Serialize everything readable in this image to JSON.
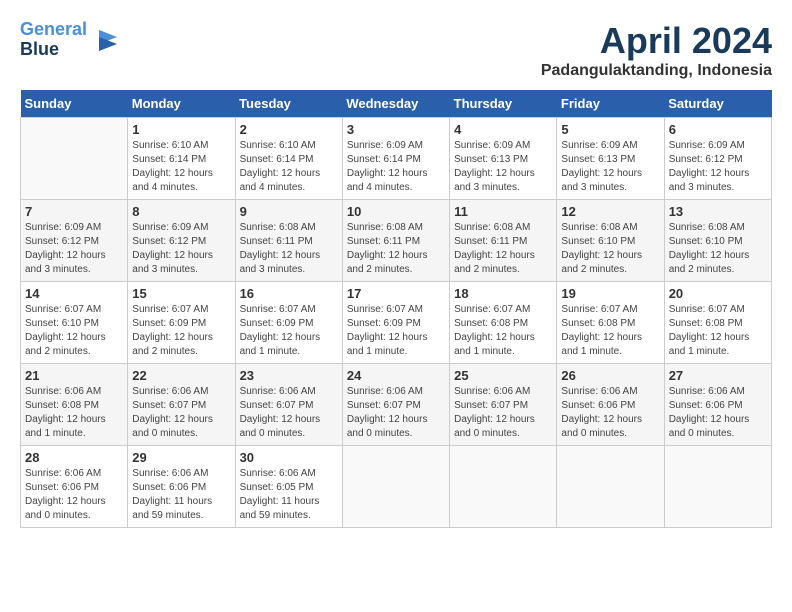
{
  "header": {
    "logo_line1": "General",
    "logo_line2": "Blue",
    "month_title": "April 2024",
    "location": "Padangulaktanding, Indonesia"
  },
  "days_of_week": [
    "Sunday",
    "Monday",
    "Tuesday",
    "Wednesday",
    "Thursday",
    "Friday",
    "Saturday"
  ],
  "weeks": [
    [
      {
        "day": "",
        "info": ""
      },
      {
        "day": "1",
        "info": "Sunrise: 6:10 AM\nSunset: 6:14 PM\nDaylight: 12 hours\nand 4 minutes."
      },
      {
        "day": "2",
        "info": "Sunrise: 6:10 AM\nSunset: 6:14 PM\nDaylight: 12 hours\nand 4 minutes."
      },
      {
        "day": "3",
        "info": "Sunrise: 6:09 AM\nSunset: 6:14 PM\nDaylight: 12 hours\nand 4 minutes."
      },
      {
        "day": "4",
        "info": "Sunrise: 6:09 AM\nSunset: 6:13 PM\nDaylight: 12 hours\nand 3 minutes."
      },
      {
        "day": "5",
        "info": "Sunrise: 6:09 AM\nSunset: 6:13 PM\nDaylight: 12 hours\nand 3 minutes."
      },
      {
        "day": "6",
        "info": "Sunrise: 6:09 AM\nSunset: 6:12 PM\nDaylight: 12 hours\nand 3 minutes."
      }
    ],
    [
      {
        "day": "7",
        "info": "Sunrise: 6:09 AM\nSunset: 6:12 PM\nDaylight: 12 hours\nand 3 minutes."
      },
      {
        "day": "8",
        "info": "Sunrise: 6:09 AM\nSunset: 6:12 PM\nDaylight: 12 hours\nand 3 minutes."
      },
      {
        "day": "9",
        "info": "Sunrise: 6:08 AM\nSunset: 6:11 PM\nDaylight: 12 hours\nand 3 minutes."
      },
      {
        "day": "10",
        "info": "Sunrise: 6:08 AM\nSunset: 6:11 PM\nDaylight: 12 hours\nand 2 minutes."
      },
      {
        "day": "11",
        "info": "Sunrise: 6:08 AM\nSunset: 6:11 PM\nDaylight: 12 hours\nand 2 minutes."
      },
      {
        "day": "12",
        "info": "Sunrise: 6:08 AM\nSunset: 6:10 PM\nDaylight: 12 hours\nand 2 minutes."
      },
      {
        "day": "13",
        "info": "Sunrise: 6:08 AM\nSunset: 6:10 PM\nDaylight: 12 hours\nand 2 minutes."
      }
    ],
    [
      {
        "day": "14",
        "info": "Sunrise: 6:07 AM\nSunset: 6:10 PM\nDaylight: 12 hours\nand 2 minutes."
      },
      {
        "day": "15",
        "info": "Sunrise: 6:07 AM\nSunset: 6:09 PM\nDaylight: 12 hours\nand 2 minutes."
      },
      {
        "day": "16",
        "info": "Sunrise: 6:07 AM\nSunset: 6:09 PM\nDaylight: 12 hours\nand 1 minute."
      },
      {
        "day": "17",
        "info": "Sunrise: 6:07 AM\nSunset: 6:09 PM\nDaylight: 12 hours\nand 1 minute."
      },
      {
        "day": "18",
        "info": "Sunrise: 6:07 AM\nSunset: 6:08 PM\nDaylight: 12 hours\nand 1 minute."
      },
      {
        "day": "19",
        "info": "Sunrise: 6:07 AM\nSunset: 6:08 PM\nDaylight: 12 hours\nand 1 minute."
      },
      {
        "day": "20",
        "info": "Sunrise: 6:07 AM\nSunset: 6:08 PM\nDaylight: 12 hours\nand 1 minute."
      }
    ],
    [
      {
        "day": "21",
        "info": "Sunrise: 6:06 AM\nSunset: 6:08 PM\nDaylight: 12 hours\nand 1 minute."
      },
      {
        "day": "22",
        "info": "Sunrise: 6:06 AM\nSunset: 6:07 PM\nDaylight: 12 hours\nand 0 minutes."
      },
      {
        "day": "23",
        "info": "Sunrise: 6:06 AM\nSunset: 6:07 PM\nDaylight: 12 hours\nand 0 minutes."
      },
      {
        "day": "24",
        "info": "Sunrise: 6:06 AM\nSunset: 6:07 PM\nDaylight: 12 hours\nand 0 minutes."
      },
      {
        "day": "25",
        "info": "Sunrise: 6:06 AM\nSunset: 6:07 PM\nDaylight: 12 hours\nand 0 minutes."
      },
      {
        "day": "26",
        "info": "Sunrise: 6:06 AM\nSunset: 6:06 PM\nDaylight: 12 hours\nand 0 minutes."
      },
      {
        "day": "27",
        "info": "Sunrise: 6:06 AM\nSunset: 6:06 PM\nDaylight: 12 hours\nand 0 minutes."
      }
    ],
    [
      {
        "day": "28",
        "info": "Sunrise: 6:06 AM\nSunset: 6:06 PM\nDaylight: 12 hours\nand 0 minutes."
      },
      {
        "day": "29",
        "info": "Sunrise: 6:06 AM\nSunset: 6:06 PM\nDaylight: 11 hours\nand 59 minutes."
      },
      {
        "day": "30",
        "info": "Sunrise: 6:06 AM\nSunset: 6:05 PM\nDaylight: 11 hours\nand 59 minutes."
      },
      {
        "day": "",
        "info": ""
      },
      {
        "day": "",
        "info": ""
      },
      {
        "day": "",
        "info": ""
      },
      {
        "day": "",
        "info": ""
      }
    ]
  ]
}
